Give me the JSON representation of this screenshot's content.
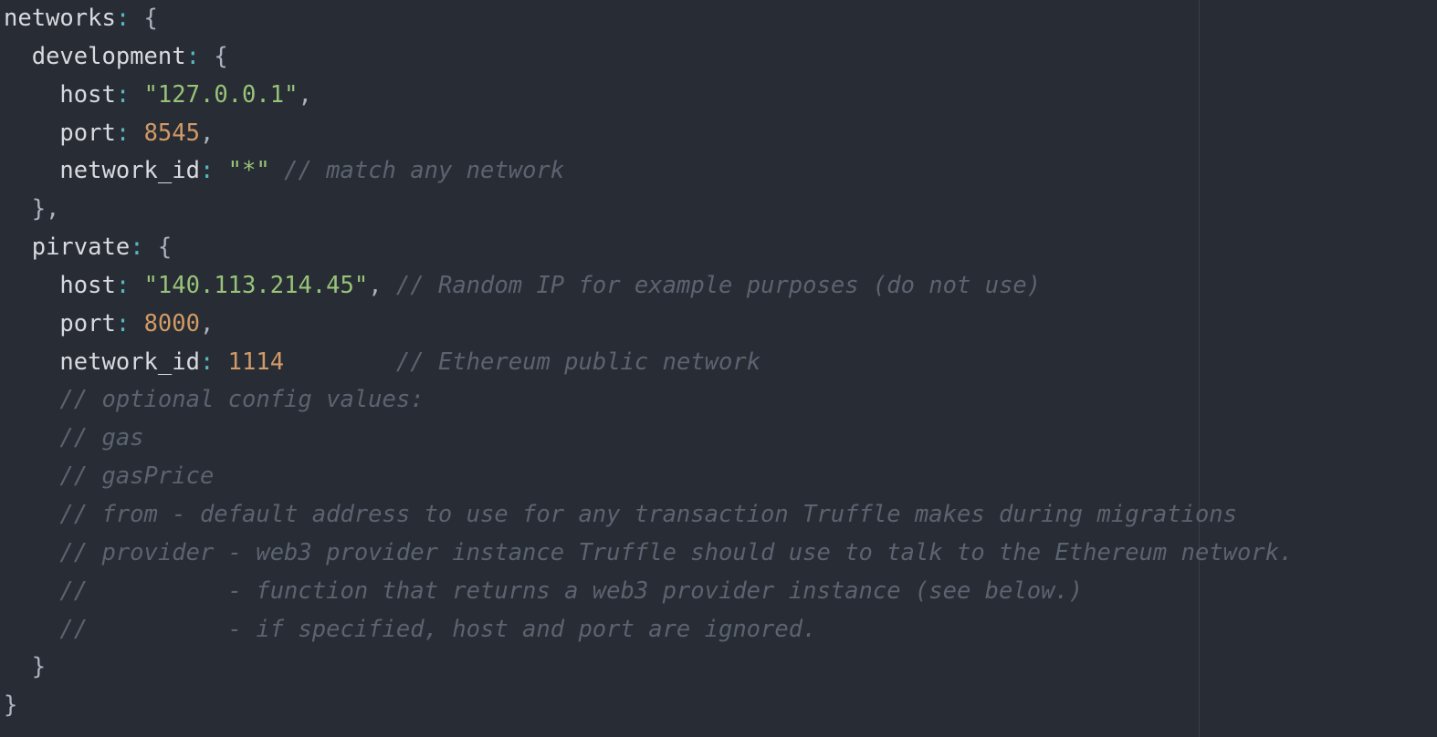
{
  "editor": {
    "colors": {
      "background": "#282c34",
      "text": "#abb2bf",
      "property": "#d7dae0",
      "colon": "#56b6c2",
      "string": "#98c379",
      "number": "#d19a66",
      "comment": "#5c6370",
      "wrap_guide": "#3a3f4b"
    },
    "lines": [
      [
        [
          "prop",
          "networks"
        ],
        [
          "colon",
          ":"
        ],
        [
          "plain",
          " {"
        ]
      ],
      [
        [
          "plain",
          "  "
        ],
        [
          "prop",
          "development"
        ],
        [
          "colon",
          ":"
        ],
        [
          "plain",
          " {"
        ]
      ],
      [
        [
          "plain",
          "    "
        ],
        [
          "prop",
          "host"
        ],
        [
          "colon",
          ":"
        ],
        [
          "plain",
          " "
        ],
        [
          "string",
          "\"127.0.0.1\""
        ],
        [
          "plain",
          ","
        ]
      ],
      [
        [
          "plain",
          "    "
        ],
        [
          "prop",
          "port"
        ],
        [
          "colon",
          ":"
        ],
        [
          "plain",
          " "
        ],
        [
          "number",
          "8545"
        ],
        [
          "plain",
          ","
        ]
      ],
      [
        [
          "plain",
          "    "
        ],
        [
          "prop",
          "network_id"
        ],
        [
          "colon",
          ":"
        ],
        [
          "plain",
          " "
        ],
        [
          "string",
          "\"*\""
        ],
        [
          "plain",
          " "
        ],
        [
          "comment",
          "// match any network"
        ]
      ],
      [
        [
          "plain",
          "  },"
        ]
      ],
      [
        [
          "plain",
          "  "
        ],
        [
          "prop",
          "pirvate"
        ],
        [
          "colon",
          ":"
        ],
        [
          "plain",
          " {"
        ]
      ],
      [
        [
          "plain",
          "    "
        ],
        [
          "prop",
          "host"
        ],
        [
          "colon",
          ":"
        ],
        [
          "plain",
          " "
        ],
        [
          "string",
          "\"140.113.214.45\""
        ],
        [
          "plain",
          ", "
        ],
        [
          "comment",
          "// Random IP for example purposes (do not use)"
        ]
      ],
      [
        [
          "plain",
          "    "
        ],
        [
          "prop",
          "port"
        ],
        [
          "colon",
          ":"
        ],
        [
          "plain",
          " "
        ],
        [
          "number",
          "8000"
        ],
        [
          "plain",
          ","
        ]
      ],
      [
        [
          "plain",
          "    "
        ],
        [
          "prop",
          "network_id"
        ],
        [
          "colon",
          ":"
        ],
        [
          "plain",
          " "
        ],
        [
          "number",
          "1114"
        ],
        [
          "plain",
          "        "
        ],
        [
          "comment",
          "// Ethereum public network"
        ]
      ],
      [
        [
          "plain",
          "    "
        ],
        [
          "comment",
          "// optional config values:"
        ]
      ],
      [
        [
          "plain",
          "    "
        ],
        [
          "comment",
          "// gas"
        ]
      ],
      [
        [
          "plain",
          "    "
        ],
        [
          "comment",
          "// gasPrice"
        ]
      ],
      [
        [
          "plain",
          "    "
        ],
        [
          "comment",
          "// from - default address to use for any transaction Truffle makes during migrations"
        ]
      ],
      [
        [
          "plain",
          "    "
        ],
        [
          "comment",
          "// provider - web3 provider instance Truffle should use to talk to the Ethereum network."
        ]
      ],
      [
        [
          "plain",
          "    "
        ],
        [
          "comment",
          "//          - function that returns a web3 provider instance (see below.)"
        ]
      ],
      [
        [
          "plain",
          "    "
        ],
        [
          "comment",
          "//          - if specified, host and port are ignored."
        ]
      ],
      [
        [
          "plain",
          "  }"
        ]
      ],
      [
        [
          "plain",
          "}"
        ]
      ]
    ]
  }
}
